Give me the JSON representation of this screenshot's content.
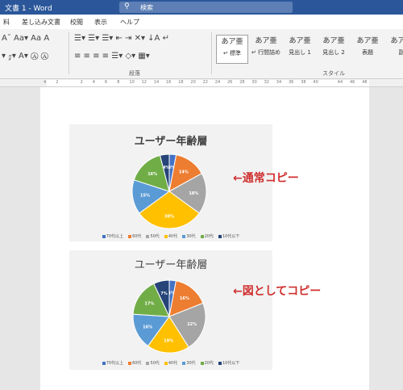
{
  "title_bar": {
    "doc_title": "文書 1 - Word",
    "search_placeholder": "検索"
  },
  "menu_tabs": [
    "料",
    "差し込み文書",
    "校閲",
    "表示",
    "ヘルプ"
  ],
  "ribbon": {
    "font_row1": "A˘ Aa▾ Aa A",
    "font_row2": "▾ 𝓏▾ A▾ Ⓐ Ⓐ",
    "para_row1": "☰▾ ☰▾ ☰▾  ⇤ ⇥  ✕▾  ↓A ↵",
    "para_row2": "≡ ≡ ≡ ≡  ☰▾  ◇▾ ▦▾",
    "paragraph_label": "段落",
    "styles_label": "スタイル",
    "styles": [
      {
        "sample": "あア亜",
        "label": "↵ 標準",
        "selected": true
      },
      {
        "sample": "あア亜",
        "label": "↵ 行間詰め",
        "selected": false
      },
      {
        "sample": "あア亜",
        "label": "見出し 1",
        "selected": false
      },
      {
        "sample": "あア亜",
        "label": "見出し 2",
        "selected": false
      },
      {
        "sample": "あア亜",
        "label": "表題",
        "selected": false
      },
      {
        "sample": "あア亜",
        "label": "副",
        "selected": false
      }
    ]
  },
  "ruler_numbers": [
    "4",
    "2",
    "",
    "2",
    "4",
    "6",
    "8",
    "10",
    "12",
    "14",
    "16",
    "18",
    "20",
    "22",
    "24",
    "26",
    "28",
    "30",
    "32",
    "34",
    "36",
    "38",
    "40",
    "",
    "44",
    "46",
    "48"
  ],
  "annotations": {
    "normal_copy": "←通常コピー",
    "image_copy": "←図としてコピー"
  },
  "colors": {
    "c70plus": "#4472c4",
    "c60s": "#ed7d31",
    "c50s": "#a5a5a5",
    "c40s": "#ffc000",
    "c30s": "#5b9bd5",
    "c20s": "#70ad47",
    "c10under": "#264478"
  },
  "chart_data": [
    {
      "type": "pie",
      "title": "ユーザー年齢層",
      "categories": [
        "70代以上",
        "60代",
        "50代",
        "40代",
        "30代",
        "20代",
        "10代以下"
      ],
      "values": [
        3,
        14,
        18,
        30,
        15,
        16,
        4
      ],
      "legend_position": "bottom"
    },
    {
      "type": "pie",
      "title": "ユーザー年齢層",
      "categories": [
        "70代以上",
        "60代",
        "50代",
        "40代",
        "30代",
        "20代",
        "10代以下"
      ],
      "values": [
        3,
        16,
        22,
        19,
        16,
        17,
        7
      ],
      "legend_position": "bottom"
    }
  ]
}
